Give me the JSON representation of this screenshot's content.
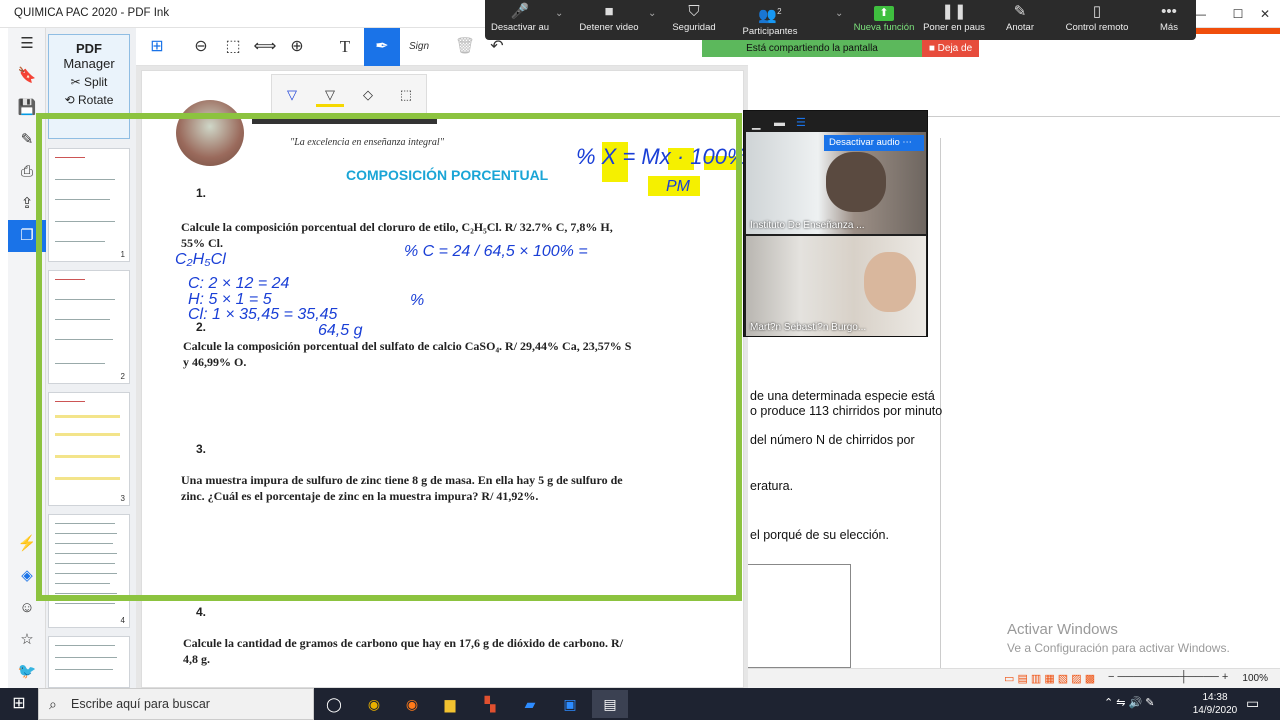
{
  "window": {
    "title": "QUIMICA PAC 2020 - PDF Ink",
    "minimize": "—",
    "maximize": "☐",
    "close": "✕"
  },
  "zoom_toolbar": {
    "buttons": [
      {
        "label": "Desactivar au",
        "icon": "microphone-icon",
        "glyph": "🎤"
      },
      {
        "label": "Detener video",
        "icon": "video-camera-icon",
        "glyph": "■"
      },
      {
        "label": "Seguridad",
        "icon": "shield-icon",
        "glyph": "⛉"
      },
      {
        "label": "Participantes",
        "icon": "participants-icon",
        "glyph": "👥",
        "badge": "2"
      },
      {
        "label": "Nueva función",
        "icon": "share-screen-icon",
        "glyph": "⬆"
      },
      {
        "label": "Poner en paus",
        "icon": "pause-icon",
        "glyph": "❚❚"
      },
      {
        "label": "Anotar",
        "icon": "annotate-pen-icon",
        "glyph": "✎"
      },
      {
        "label": "Control remoto",
        "icon": "mouse-icon",
        "glyph": "▯"
      },
      {
        "label": "Más",
        "icon": "more-icon",
        "glyph": "•••"
      }
    ],
    "sharing_text": "Está compartiendo la pantalla",
    "stop_label": "Deja de",
    "accent": "#5cb85c",
    "stop_color": "#e74c3c"
  },
  "pdf_manager": {
    "title": "PDF",
    "subtitle": "Manager",
    "split": "Split",
    "rotate": "Rotate"
  },
  "thumbnails": [
    "1",
    "2",
    "3",
    "4"
  ],
  "left_icons": [
    "hamburger-icon",
    "bookmark-icon",
    "save-icon",
    "edit-document-icon",
    "print-icon",
    "share-icon",
    "pages-icon",
    "lightning-icon",
    "layers-icon",
    "user-review-icon",
    "star-icon",
    "twitter-icon"
  ],
  "toolbar": {
    "icons": [
      "page-add-icon",
      "zoom-out-icon",
      "fit-page-icon",
      "fit-width-icon",
      "zoom-in-icon",
      "text-tool-icon",
      "pen-tool-icon",
      "sign-icon",
      "delete-icon",
      "undo-icon"
    ],
    "text_glyph": "T",
    "sign_label": "Sign",
    "accent": "#1a73e8"
  },
  "draw_tools": [
    "pen-icon",
    "highlighter-icon",
    "eraser-icon",
    "selection-icon"
  ],
  "document": {
    "motto": "\"La excelencia en enseñanza integral\"",
    "heading": "COMPOSICIÓN PORCENTUAL",
    "questions": [
      {
        "num": "1.",
        "text": "Calcule la composición porcentual del cloruro de etilo, C₂H₅Cl. R/ 32.7% C, 7,8% H, 55% Cl."
      },
      {
        "num": "2.",
        "text": "Calcule la composición porcentual del sulfato de calcio CaSO₄. R/ 29,44% Ca, 23,57% S y 46,99% O."
      },
      {
        "num": "3.",
        "text": "Una muestra impura de sulfuro de zinc tiene 8 g de masa. En ella hay 5 g de sulfuro de zinc. ¿Cuál es el porcentaje de zinc en la muestra impura? R/ 41,92%."
      },
      {
        "num": "4.",
        "text": "Calcule la cantidad de gramos de carbono que hay en 17,6 g de dióxido de carbono. R/ 4,8 g."
      }
    ],
    "handwriting": {
      "formula_top": "% X = Mx · 100%",
      "pm": "PM",
      "c2h5cl": "C₂H₅Cl",
      "calc1": "C: 2 × 12 = 24",
      "calc2": "H: 5 × 1 = 5",
      "calc3": "Cl: 1 × 35,45 = 35,45",
      "total": "64,5 g",
      "percent_c": "% C = 24 / 64,5 × 100% =",
      "percent_o": "%"
    },
    "highlight_color": "#f5f000",
    "frame_color": "#8cc33f"
  },
  "video": {
    "participant1": "Instituto De Enseñanza ...",
    "participant2": "Mart?n Sebasti?n Burgo...",
    "mute_popup": "Desactivar audio"
  },
  "background_doc": {
    "lines": [
      "de una determinada especie está",
      "o produce 113 chirridos por minuto",
      "del número N de chirridos por",
      "eratura.",
      "el porqué de su elección."
    ],
    "activate_title": "Activar Windows",
    "activate_sub": "Ve a Configuración para activar Windows.",
    "zoom_level": "100%",
    "accent": "#f04e0c"
  },
  "taskbar": {
    "search_placeholder": "Escribe aquí para buscar",
    "time": "14:38",
    "date": "14/9/2020"
  }
}
